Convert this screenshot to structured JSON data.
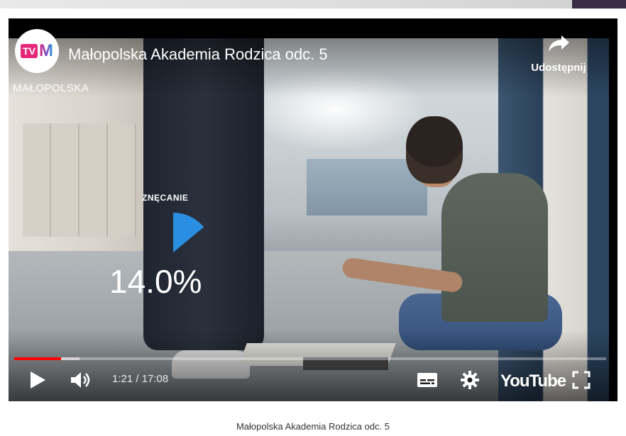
{
  "player": {
    "title": "Małopolska Akademia Rodzica odc. 5",
    "channel": {
      "name": "MAŁOPOLSKA",
      "logo_tv": "TV",
      "logo_m": "M",
      "icon": "channel-logo-icon"
    },
    "share": {
      "label": "Udostępnij",
      "icon": "share-arrow-icon"
    },
    "overlay": {
      "label": "ZNĘCANIE",
      "percent_text": "14.0%",
      "percent_value": 14.0,
      "accent": "#2a8fe0"
    },
    "controls": {
      "time": "1:21 / 17:08",
      "played_fraction": 0.079,
      "buffered_fraction": 0.11,
      "brand": "YouTube",
      "play_icon": "play-icon",
      "volume_icon": "volume-icon",
      "cc_icon": "subtitles-icon",
      "settings_icon": "gear-icon",
      "fullscreen_icon": "fullscreen-icon"
    },
    "progress_color": "#ff0000"
  },
  "caption": "Małopolska Akademia Rodzica odc. 5"
}
